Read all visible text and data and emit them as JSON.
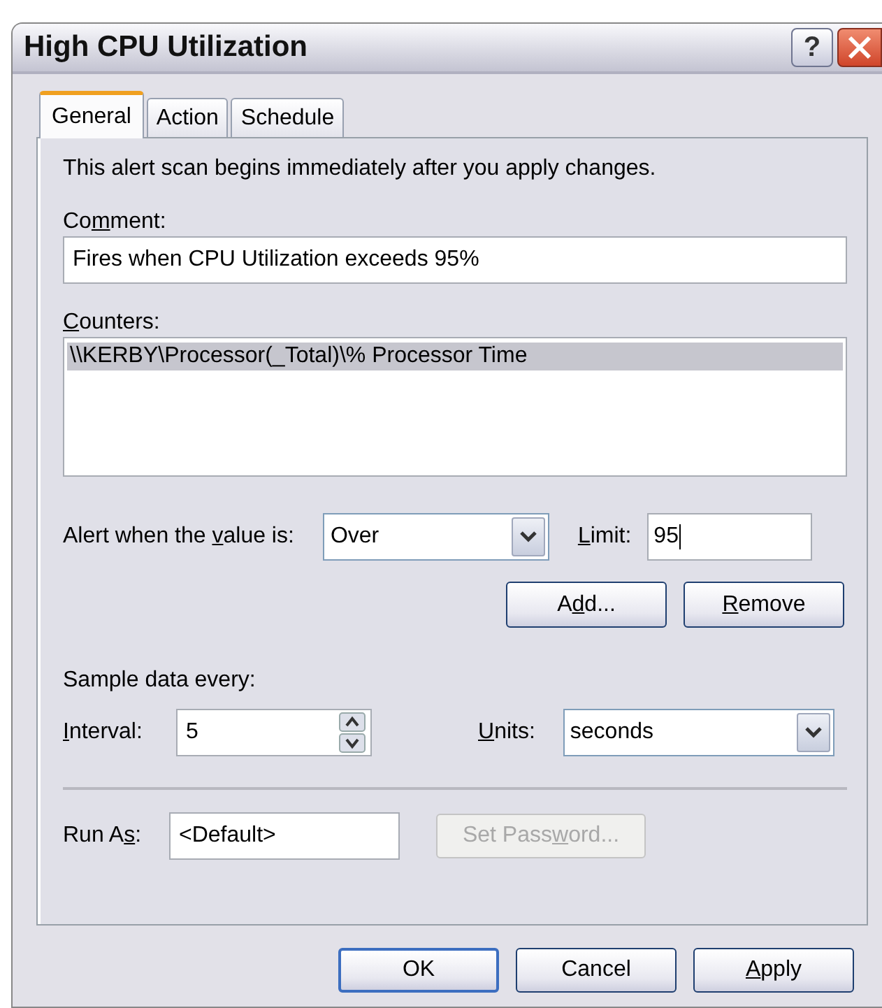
{
  "window": {
    "title": "High CPU Utilization",
    "help": "?"
  },
  "tabs": [
    {
      "label": "General",
      "selected": true
    },
    {
      "label": "Action",
      "selected": false
    },
    {
      "label": "Schedule",
      "selected": false
    }
  ],
  "description": "This alert scan begins immediately after you apply changes.",
  "comment": {
    "label": {
      "pre": "Co",
      "key": "m",
      "post": "ment:"
    },
    "value": "Fires when CPU Utilization exceeds 95%"
  },
  "counters": {
    "label": {
      "key": "C",
      "post": "ounters:"
    },
    "items": [
      {
        "text": "\\\\KERBY\\Processor(_Total)\\% Processor Time",
        "selected": true
      }
    ]
  },
  "alert": {
    "label": {
      "pre": "Alert when the ",
      "key": "v",
      "post": "alue is:"
    },
    "value": "Over"
  },
  "limit": {
    "label": {
      "key": "L",
      "post": "imit:"
    },
    "value": "95"
  },
  "list_buttons": [
    {
      "label": {
        "pre": "A",
        "key": "d",
        "post": "d..."
      },
      "disabled": false
    },
    {
      "label": {
        "key": "R",
        "post": "emove"
      },
      "disabled": false
    }
  ],
  "sample_heading": "Sample data every:",
  "interval": {
    "label": {
      "key": "I",
      "post": "nterval:"
    },
    "value": "5"
  },
  "units": {
    "label": {
      "key": "U",
      "post": "nits:"
    },
    "value": "seconds"
  },
  "run_as": {
    "label": {
      "pre": "Run A",
      "key": "s",
      "post": ":"
    },
    "value": "<Default>"
  },
  "set_password": {
    "label": {
      "pre": "Set Pass",
      "key": "w",
      "post": "ord..."
    },
    "disabled": true
  },
  "dialog_buttons": [
    {
      "label": {
        "pre": "OK"
      },
      "default": true
    },
    {
      "label": {
        "pre": "Cancel"
      },
      "default": false
    },
    {
      "label": {
        "key": "A",
        "post": "pply"
      },
      "default": false
    }
  ]
}
